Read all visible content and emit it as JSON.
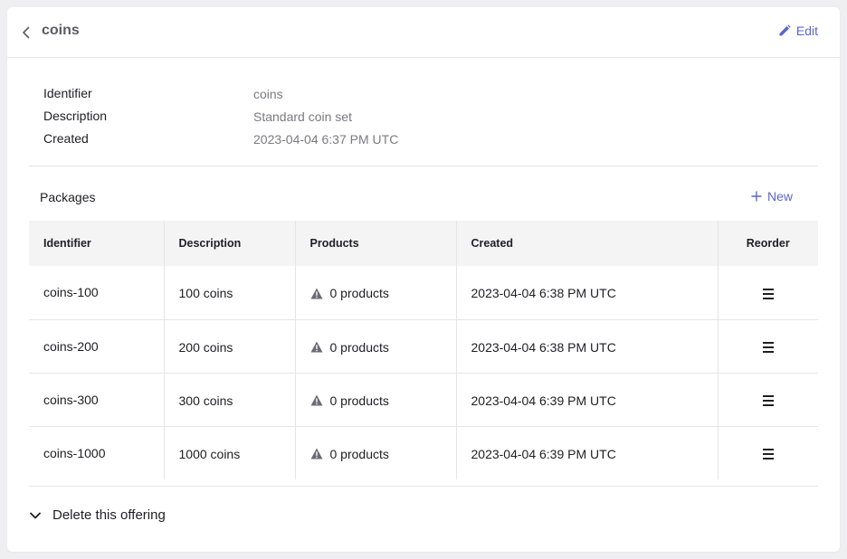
{
  "header": {
    "title": "coins",
    "edit_label": "Edit"
  },
  "details": [
    {
      "label": "Identifier",
      "value": "coins"
    },
    {
      "label": "Description",
      "value": "Standard coin set"
    },
    {
      "label": "Created",
      "value": "2023-04-04 6:37 PM UTC"
    }
  ],
  "packages": {
    "heading": "Packages",
    "new_label": "New",
    "columns": [
      "Identifier",
      "Description",
      "Products",
      "Created",
      "Reorder"
    ],
    "rows": [
      {
        "identifier": "coins-100",
        "description": "100 coins",
        "products": "0 products",
        "created": "2023-04-04 6:38 PM UTC"
      },
      {
        "identifier": "coins-200",
        "description": "200 coins",
        "products": "0 products",
        "created": "2023-04-04 6:38 PM UTC"
      },
      {
        "identifier": "coins-300",
        "description": "300 coins",
        "products": "0 products",
        "created": "2023-04-04 6:39 PM UTC"
      },
      {
        "identifier": "coins-1000",
        "description": "1000 coins",
        "products": "0 products",
        "created": "2023-04-04 6:39 PM UTC"
      }
    ]
  },
  "danger": {
    "delete_label": "Delete this offering"
  },
  "colors": {
    "accent": "#5a67c9",
    "warning_icon": "#6b6b73",
    "header_bg": "#f4f4f5"
  },
  "icons": {
    "back": "chevron-left-icon",
    "edit": "pencil-icon",
    "new": "plus-icon",
    "warning": "warning-triangle-icon",
    "reorder": "drag-handle-icon",
    "expand": "chevron-down-icon"
  }
}
